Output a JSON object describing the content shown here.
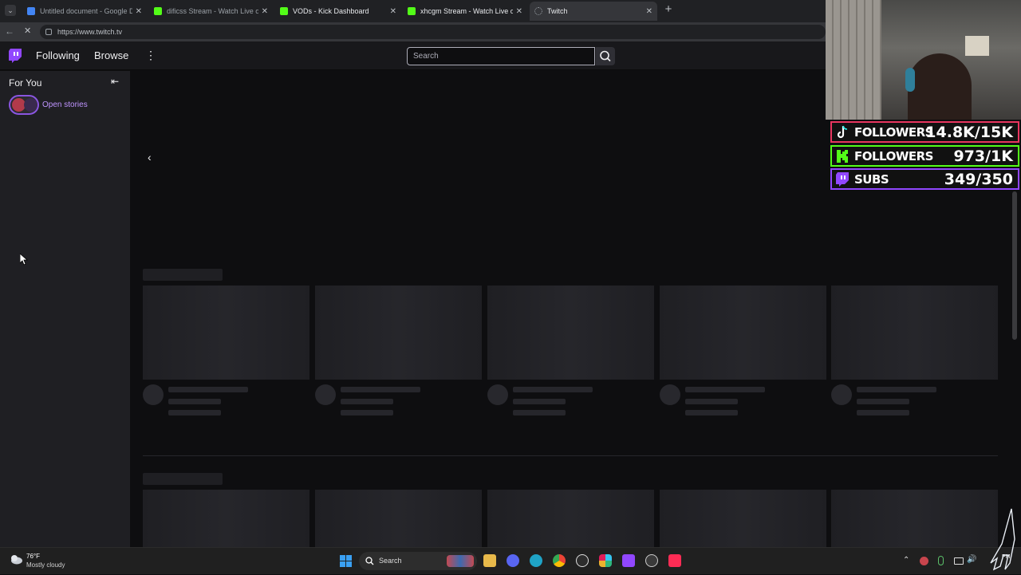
{
  "browser": {
    "tabs": [
      {
        "title": "Untitled document - Google Docs",
        "icon": "google-docs-icon",
        "color": "#4285f4"
      },
      {
        "title": "dificss Stream - Watch Live on Kick",
        "icon": "kick-icon",
        "color": "#53fc18"
      },
      {
        "title": "VODs - Kick Dashboard",
        "icon": "kick-icon",
        "color": "#53fc18"
      },
      {
        "title": "xhcgm Stream - Watch Live on Kick",
        "icon": "kick-icon",
        "color": "#53fc18"
      },
      {
        "title": "Twitch",
        "icon": "loading-icon",
        "color": "#9aa0a6"
      }
    ],
    "url": "https://www.twitch.tv"
  },
  "twitch": {
    "nav": {
      "following": "Following",
      "browse": "Browse",
      "search_placeholder": "Search"
    },
    "sidebar": {
      "heading": "For You",
      "stories_label": "Open stories"
    },
    "brand_color": "#9147ff"
  },
  "overlay": {
    "counters": [
      {
        "label": "FOLLOWERS",
        "value": "14.8K/15K",
        "icon": "tiktok-icon",
        "border": "#e8355f"
      },
      {
        "label": "FOLLOWERS",
        "value": "973/1K",
        "icon": "kick-icon",
        "border": "#53fc18"
      },
      {
        "label": "SUBS",
        "value": "349/350",
        "icon": "twitch-icon",
        "border": "#9147ff"
      }
    ]
  },
  "taskbar": {
    "weather_temp": "76°F",
    "weather_desc": "Mostly cloudy",
    "search_label": "Search",
    "clock": "PM"
  }
}
